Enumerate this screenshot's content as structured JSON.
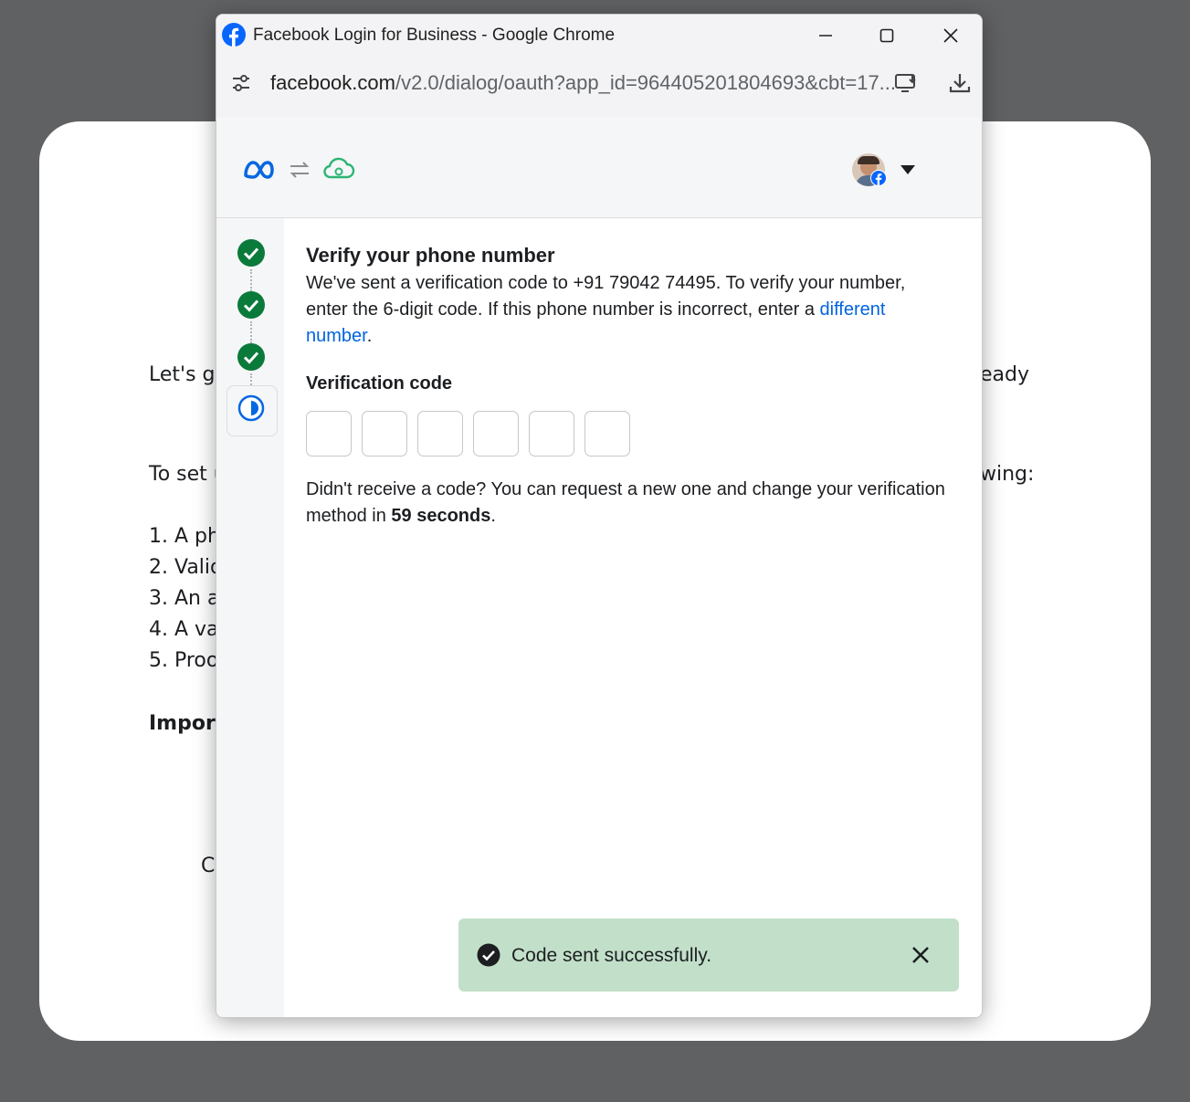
{
  "background_page": {
    "line1_left": "Let's ge",
    "line1_right": "eady",
    "line2_left": "To set u",
    "line2_right": "wing:",
    "list": [
      "1. A ph",
      "2. Valid",
      "3. An ac",
      "4. A val",
      "5. Proo"
    ],
    "important": "Import",
    "trailing": "C"
  },
  "window": {
    "title": "Facebook Login for Business - Google Chrome",
    "url_host": "facebook.com",
    "url_path": "/v2.0/dialog/oauth?app_id=964405201804693&cbt=17..."
  },
  "steps": [
    {
      "status": "complete"
    },
    {
      "status": "complete"
    },
    {
      "status": "complete"
    },
    {
      "status": "active"
    }
  ],
  "verify": {
    "heading": "Verify your phone number",
    "description_part1": "We've sent a verification code to +91 79042 74495. To verify your number, enter the 6-digit code. If this phone number is incorrect, enter a ",
    "link_text": "different number",
    "description_end": ".",
    "code_label": "Verification code",
    "code_digits": [
      "",
      "",
      "",
      "",
      "",
      ""
    ],
    "resend_text": "Didn't receive a code? You can request a new one and change your verification method in ",
    "countdown": "59 seconds",
    "resend_end": "."
  },
  "toast": {
    "message": "Code sent successfully."
  },
  "colors": {
    "meta_blue": "#0668e1",
    "step_green": "#0a7a3b",
    "link_blue": "#0064e0",
    "toast_bg": "#c2e0c9"
  }
}
